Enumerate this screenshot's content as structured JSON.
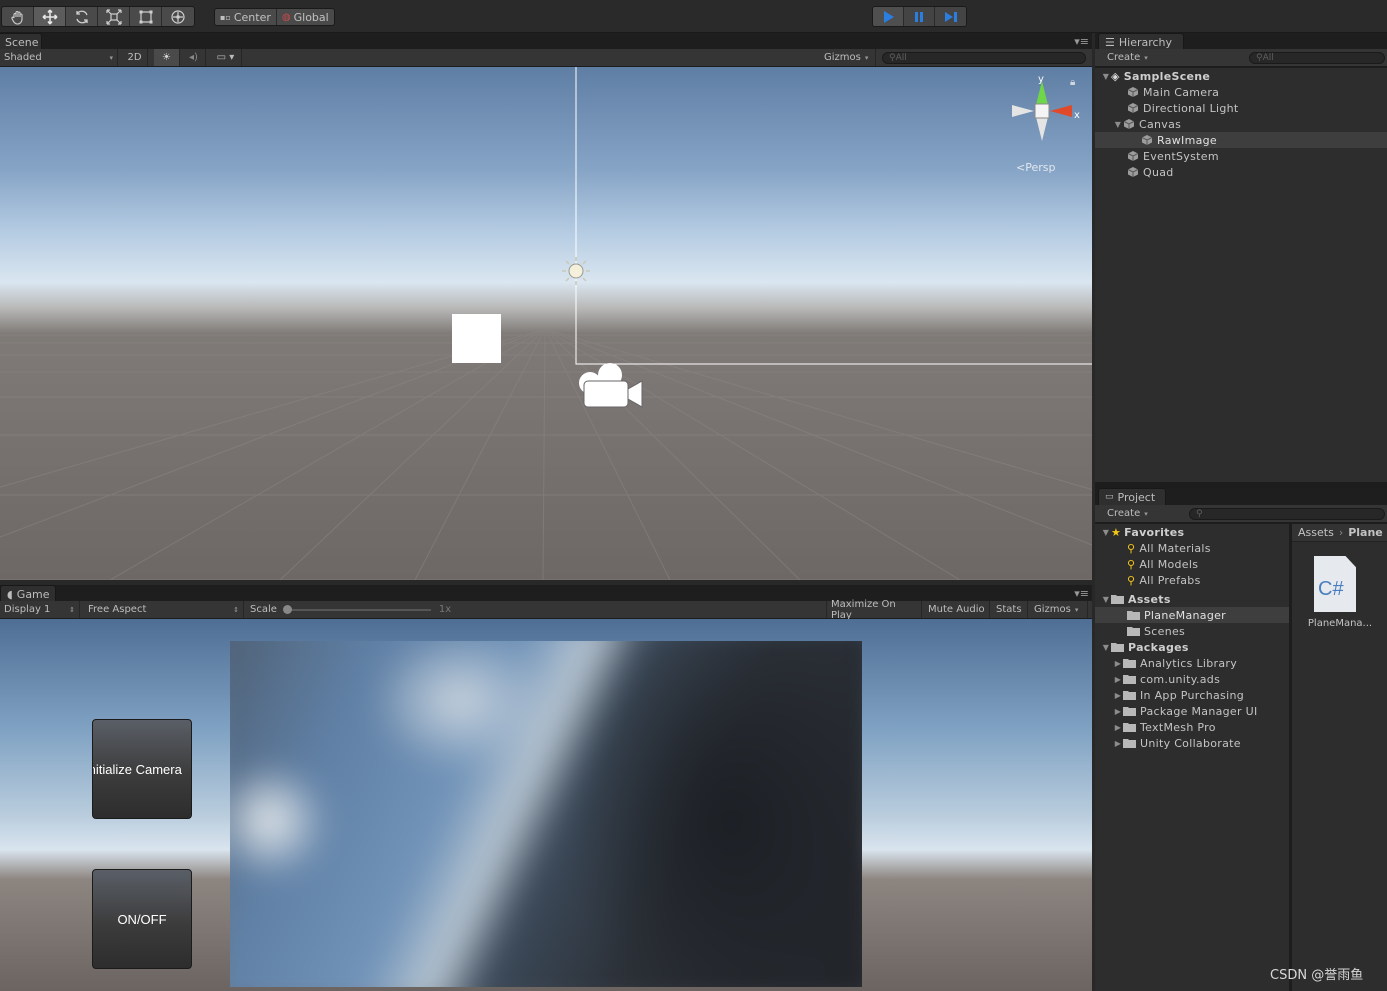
{
  "toolbar": {
    "tools": [
      "hand-tool",
      "move-tool",
      "rotate-tool",
      "scale-tool",
      "rect-tool",
      "transform-tool"
    ],
    "pivot_mode_label": "Center",
    "pivot_rotation_label": "Global",
    "accent": "#2a7ee0"
  },
  "scene": {
    "tab_label": "Scene",
    "shading_mode": "Shaded",
    "mode_2d_label": "2D",
    "gizmos_label": "Gizmos",
    "search_placeholder": "All",
    "projection_label": "Persp",
    "axis_y": "y",
    "axis_x": "x"
  },
  "game": {
    "tab_label": "Game",
    "display_label": "Display 1",
    "aspect_label": "Free Aspect",
    "scale_label": "Scale",
    "scale_value": "1x",
    "maximize_label": "Maximize On Play",
    "mute_label": "Mute Audio",
    "stats_label": "Stats",
    "gizmos_label": "Gizmos",
    "button_initialize_label": "Initialize Camera",
    "button_onoff_label": "ON/OFF"
  },
  "hierarchy": {
    "tab_label": "Hierarchy",
    "create_label": "Create",
    "search_placeholder": "All",
    "scene_name": "SampleScene",
    "items": [
      {
        "label": "Main Camera"
      },
      {
        "label": "Directional Light"
      },
      {
        "label": "Canvas"
      },
      {
        "label": "RawImage"
      },
      {
        "label": "EventSystem"
      },
      {
        "label": "Quad"
      }
    ]
  },
  "project": {
    "tab_label": "Project",
    "create_label": "Create",
    "favorites_label": "Favorites",
    "favorites": [
      "All Materials",
      "All Models",
      "All Prefabs"
    ],
    "assets_label": "Assets",
    "assets": [
      "PlaneManager",
      "Scenes"
    ],
    "packages_label": "Packages",
    "packages": [
      "Analytics Library",
      "com.unity.ads",
      "In App Purchasing",
      "Package Manager UI",
      "TextMesh Pro",
      "Unity Collaborate"
    ],
    "breadcrumb_root": "Assets",
    "breadcrumb_current": "Plane",
    "file_icon_text": "C#",
    "file_label": "PlaneMana..."
  },
  "watermark": "CSDN @誉雨鱼"
}
